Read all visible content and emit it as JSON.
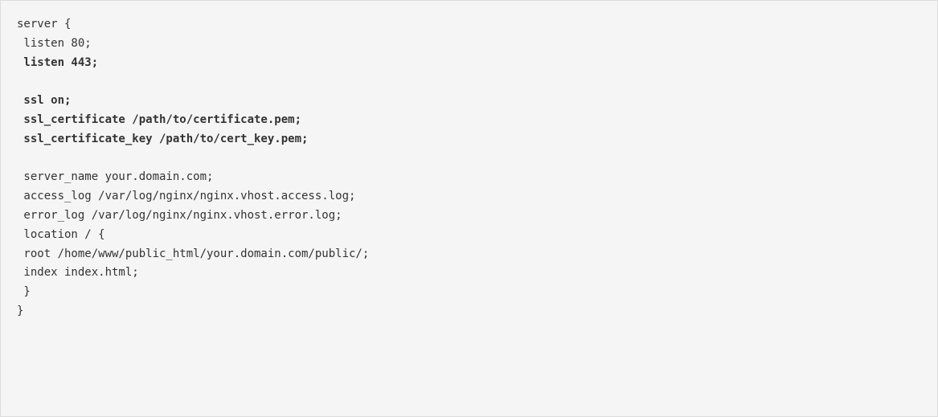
{
  "code": {
    "lines": [
      {
        "text": "server {",
        "indent": 0,
        "bold": false
      },
      {
        "text": "listen 80;",
        "indent": 1,
        "bold": false
      },
      {
        "text": "listen 443;",
        "indent": 1,
        "bold": true
      },
      {
        "text": "",
        "indent": 0,
        "bold": false
      },
      {
        "text": "ssl on;",
        "indent": 1,
        "bold": true
      },
      {
        "text": "ssl_certificate /path/to/certificate.pem;",
        "indent": 1,
        "bold": true
      },
      {
        "text": "ssl_certificate_key /path/to/cert_key.pem;",
        "indent": 1,
        "bold": true
      },
      {
        "text": "",
        "indent": 0,
        "bold": false
      },
      {
        "text": "server_name your.domain.com;",
        "indent": 1,
        "bold": false
      },
      {
        "text": "access_log /var/log/nginx/nginx.vhost.access.log;",
        "indent": 1,
        "bold": false
      },
      {
        "text": "error_log /var/log/nginx/nginx.vhost.error.log;",
        "indent": 1,
        "bold": false
      },
      {
        "text": "location / {",
        "indent": 1,
        "bold": false
      },
      {
        "text": "root /home/www/public_html/your.domain.com/public/;",
        "indent": 1,
        "bold": false
      },
      {
        "text": "index index.html;",
        "indent": 1,
        "bold": false
      },
      {
        "text": "}",
        "indent": 1,
        "bold": false
      },
      {
        "text": "}",
        "indent": 0,
        "bold": false
      }
    ]
  }
}
